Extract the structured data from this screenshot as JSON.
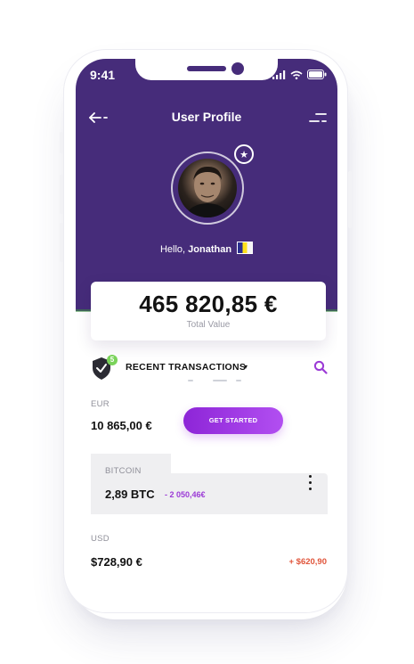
{
  "status_bar": {
    "time": "9:41"
  },
  "header": {
    "title": "User Profile"
  },
  "profile": {
    "greeting_prefix": "Hello, ",
    "name": "Jonathan"
  },
  "total": {
    "value": "465 820,85 €",
    "label": "Total Value"
  },
  "transactions": {
    "badge_count": "5",
    "label": "RECENT TRANSACTIONS",
    "chevron": "▾",
    "accounts": [
      {
        "label": "EUR",
        "amount": "10 865,00 €",
        "action": "GET STARTED"
      },
      {
        "label": "BITCOIN",
        "amount": "2,89 BTC",
        "change": "- 2 050,46€"
      },
      {
        "label": "USD",
        "amount": "$728,90 €",
        "change": "+ $620,90"
      }
    ]
  },
  "icons": {
    "back": "back-arrow-icon",
    "menu": "menu-icon",
    "star": "star-icon",
    "shield": "shield-check-icon",
    "search": "search-icon",
    "more": "more-vertical-icon",
    "flag": "flag-icon"
  },
  "colors": {
    "header": "#462c7a",
    "accent": "#9b3ad6",
    "positive_badge": "#7ad35a",
    "negative_change": "#9b3ad6",
    "positive_change": "#e0543a"
  }
}
